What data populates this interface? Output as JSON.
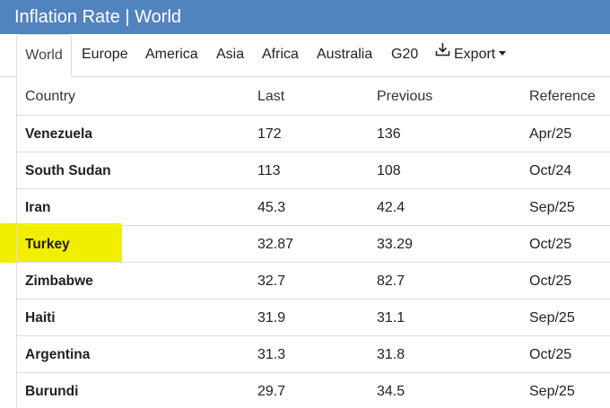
{
  "header": {
    "title": "Inflation Rate | World"
  },
  "tabs": [
    {
      "label": "World",
      "active": true
    },
    {
      "label": "Europe"
    },
    {
      "label": "America"
    },
    {
      "label": "Asia"
    },
    {
      "label": "Africa"
    },
    {
      "label": "Australia"
    },
    {
      "label": "G20"
    },
    {
      "label": "Export",
      "icon": "download-icon",
      "dropdown": true
    }
  ],
  "table": {
    "columns": [
      "Country",
      "Last",
      "Previous",
      "Reference"
    ],
    "rows": [
      {
        "country": "Venezuela",
        "last": "172",
        "previous": "136",
        "reference": "Apr/25"
      },
      {
        "country": "South Sudan",
        "last": "113",
        "previous": "108",
        "reference": "Oct/24"
      },
      {
        "country": "Iran",
        "last": "45.3",
        "previous": "42.4",
        "reference": "Sep/25"
      },
      {
        "country": "Turkey",
        "last": "32.87",
        "previous": "33.29",
        "reference": "Oct/25",
        "highlighted": true
      },
      {
        "country": "Zimbabwe",
        "last": "32.7",
        "previous": "82.7",
        "reference": "Oct/25"
      },
      {
        "country": "Haiti",
        "last": "31.9",
        "previous": "31.1",
        "reference": "Sep/25"
      },
      {
        "country": "Argentina",
        "last": "31.3",
        "previous": "31.8",
        "reference": "Oct/25"
      },
      {
        "country": "Burundi",
        "last": "29.7",
        "previous": "34.5",
        "reference": "Sep/25"
      }
    ]
  },
  "colors": {
    "header_bg": "#5183bf",
    "highlight": "#f2ee00",
    "border": "#dddddd"
  }
}
